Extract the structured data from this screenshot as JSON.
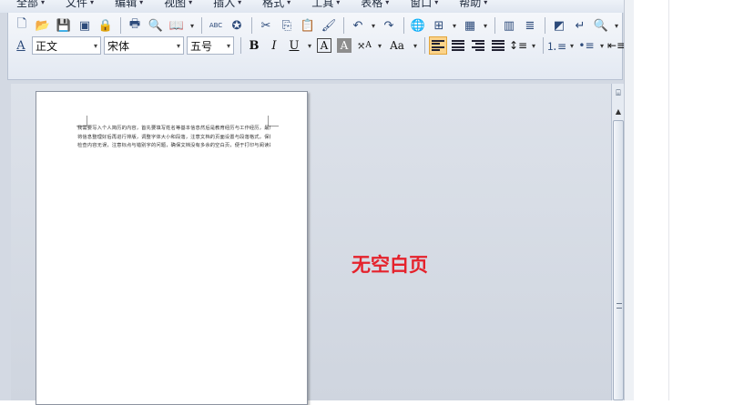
{
  "menu": [
    {
      "label": "全部",
      "arrow": "▾"
    },
    {
      "label": "文件",
      "arrow": "▾"
    },
    {
      "label": "编辑",
      "arrow": "▾"
    },
    {
      "label": "视图",
      "arrow": "▾"
    },
    {
      "label": "插入",
      "arrow": "▾"
    },
    {
      "label": "格式",
      "arrow": "▾"
    },
    {
      "label": "工具",
      "arrow": "▾"
    },
    {
      "label": "表格",
      "arrow": "▾"
    },
    {
      "label": "窗口",
      "arrow": "▾"
    },
    {
      "label": "帮助",
      "arrow": "▾"
    }
  ],
  "toolbar1_icons": [
    {
      "name": "new-doc-icon",
      "glyph": "🗋"
    },
    {
      "name": "open-folder-icon",
      "glyph": "📂"
    },
    {
      "name": "save-icon",
      "glyph": "💾"
    },
    {
      "name": "save-all-icon",
      "glyph": "▣"
    },
    {
      "name": "permission-icon",
      "glyph": "🔒"
    },
    {
      "name": "print-icon",
      "glyph": "🖶"
    },
    {
      "name": "print-preview-icon",
      "glyph": "🔍"
    },
    {
      "name": "read-mode-icon",
      "glyph": "📖"
    },
    {
      "name": "spelling-icon",
      "glyph": "ABC"
    },
    {
      "name": "research-icon",
      "glyph": "✪"
    },
    {
      "name": "cut-icon",
      "glyph": "✂"
    },
    {
      "name": "copy-icon",
      "glyph": "⎘"
    },
    {
      "name": "paste-icon",
      "glyph": "📋"
    },
    {
      "name": "format-painter-icon",
      "glyph": "🖌"
    },
    {
      "name": "undo-icon",
      "glyph": "↶"
    },
    {
      "name": "redo-icon",
      "glyph": "↷"
    },
    {
      "name": "hyperlink-icon",
      "glyph": "🌐"
    },
    {
      "name": "borders-icon",
      "glyph": "⊞"
    },
    {
      "name": "table-icon",
      "glyph": "▦"
    },
    {
      "name": "columns-icon",
      "glyph": "▥"
    },
    {
      "name": "text-direction-icon",
      "glyph": "≣"
    },
    {
      "name": "drawing-icon",
      "glyph": "◩"
    },
    {
      "name": "show-marks-icon",
      "glyph": "↵"
    },
    {
      "name": "zoom-icon",
      "glyph": "🔍"
    }
  ],
  "style_combo": {
    "value": "正文",
    "icon": "A"
  },
  "font_combo": {
    "value": "宋体"
  },
  "size_combo": {
    "value": "五号"
  },
  "format_buttons": {
    "bold": "B",
    "italic": "I",
    "underline": "U",
    "border_char": "A",
    "shading_char": "A",
    "char_scale": "A",
    "change_case": "Aa"
  },
  "annotation": "无空白页",
  "document": {
    "lines": [
      "我需要写入个人简历的内容，首先要填写姓名等基本信息然后是教育经历与工作经历，最后写上自我评价",
      "将信息整理好后再进行排版，调整字体大小和段落，注意文档的页面设置与段落格式，保持整体简洁美观",
      "检查内容无误，注意标点与错别字的问题，确保文档没有多余的空白页，便于打印与阅读的最终效果呈现"
    ]
  },
  "colors": {
    "accent_active": "#fbd38a",
    "annotation_red": "#e5222c"
  }
}
